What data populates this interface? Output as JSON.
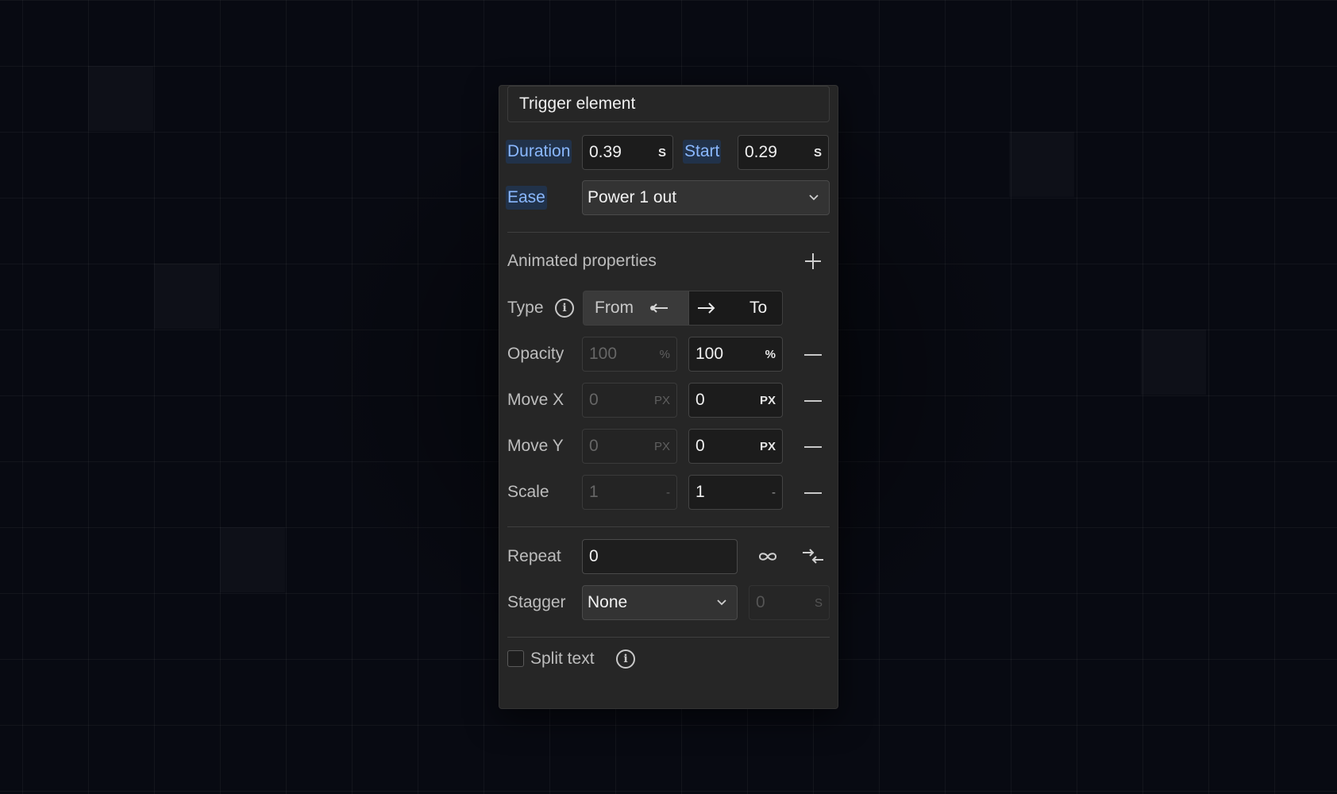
{
  "trigger": {
    "value": "Trigger element"
  },
  "duration": {
    "label": "Duration",
    "value": "0.39",
    "unit": "S"
  },
  "start": {
    "label": "Start",
    "value": "0.29",
    "unit": "S"
  },
  "ease": {
    "label": "Ease",
    "value": "Power 1 out"
  },
  "animated": {
    "title": "Animated properties",
    "type_label": "Type",
    "from_label": "From",
    "to_label": "To"
  },
  "properties": [
    {
      "label": "Opacity",
      "from": "100",
      "from_unit": "%",
      "to": "100",
      "to_unit": "%"
    },
    {
      "label": "Move X",
      "from": "0",
      "from_unit": "PX",
      "to": "0",
      "to_unit": "PX"
    },
    {
      "label": "Move Y",
      "from": "0",
      "from_unit": "PX",
      "to": "0",
      "to_unit": "PX"
    },
    {
      "label": "Scale",
      "from": "1",
      "from_unit": "-",
      "to": "1",
      "to_unit": "-"
    }
  ],
  "repeat": {
    "label": "Repeat",
    "value": "0"
  },
  "stagger": {
    "label": "Stagger",
    "value": "None",
    "amount": "0",
    "unit": "S"
  },
  "split_text": {
    "label": "Split text",
    "checked": false
  },
  "colors": {
    "accent": "#8ab8ff",
    "panel": "#262626",
    "background": "#080a12"
  },
  "icons": [
    "info-icon",
    "plus-icon",
    "minus-icon",
    "chevron-down-icon",
    "arrow-left-icon",
    "arrow-right-icon",
    "infinity-icon",
    "yoyo-icon"
  ]
}
